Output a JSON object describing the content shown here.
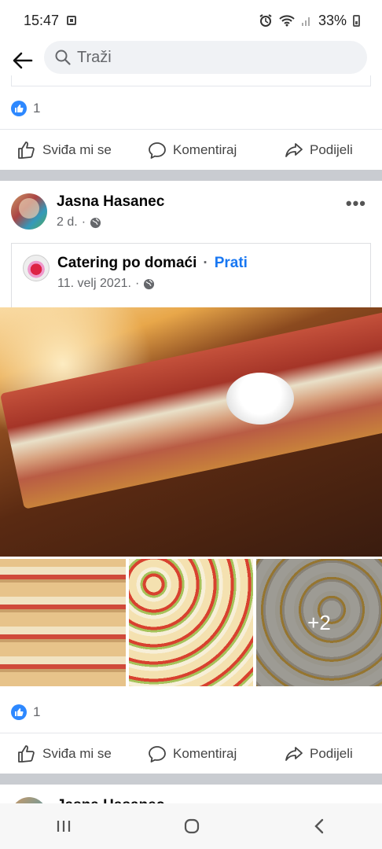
{
  "status_bar": {
    "time": "15:47",
    "battery": "33%"
  },
  "search": {
    "placeholder": "Traži"
  },
  "previous_post": {
    "reaction_count": "1",
    "actions": {
      "like": "Sviđa mi se",
      "comment": "Komentiraj",
      "share": "Podijeli"
    }
  },
  "post": {
    "author": "Jasna Hasanec",
    "time": "2 d.",
    "shared": {
      "page_name": "Catering po domaći",
      "follow_label": "Prati",
      "date": "11. velj 2021."
    },
    "photos": {
      "more_count": "+2"
    },
    "reaction_count": "1",
    "actions": {
      "like": "Sviđa mi se",
      "comment": "Komentiraj",
      "share": "Podijeli"
    }
  },
  "next_post": {
    "author": "Jasna Hasanec"
  },
  "colors": {
    "accent": "#1877f2",
    "separator": "#c9ccd1",
    "like_badge": "#2d88ff"
  }
}
